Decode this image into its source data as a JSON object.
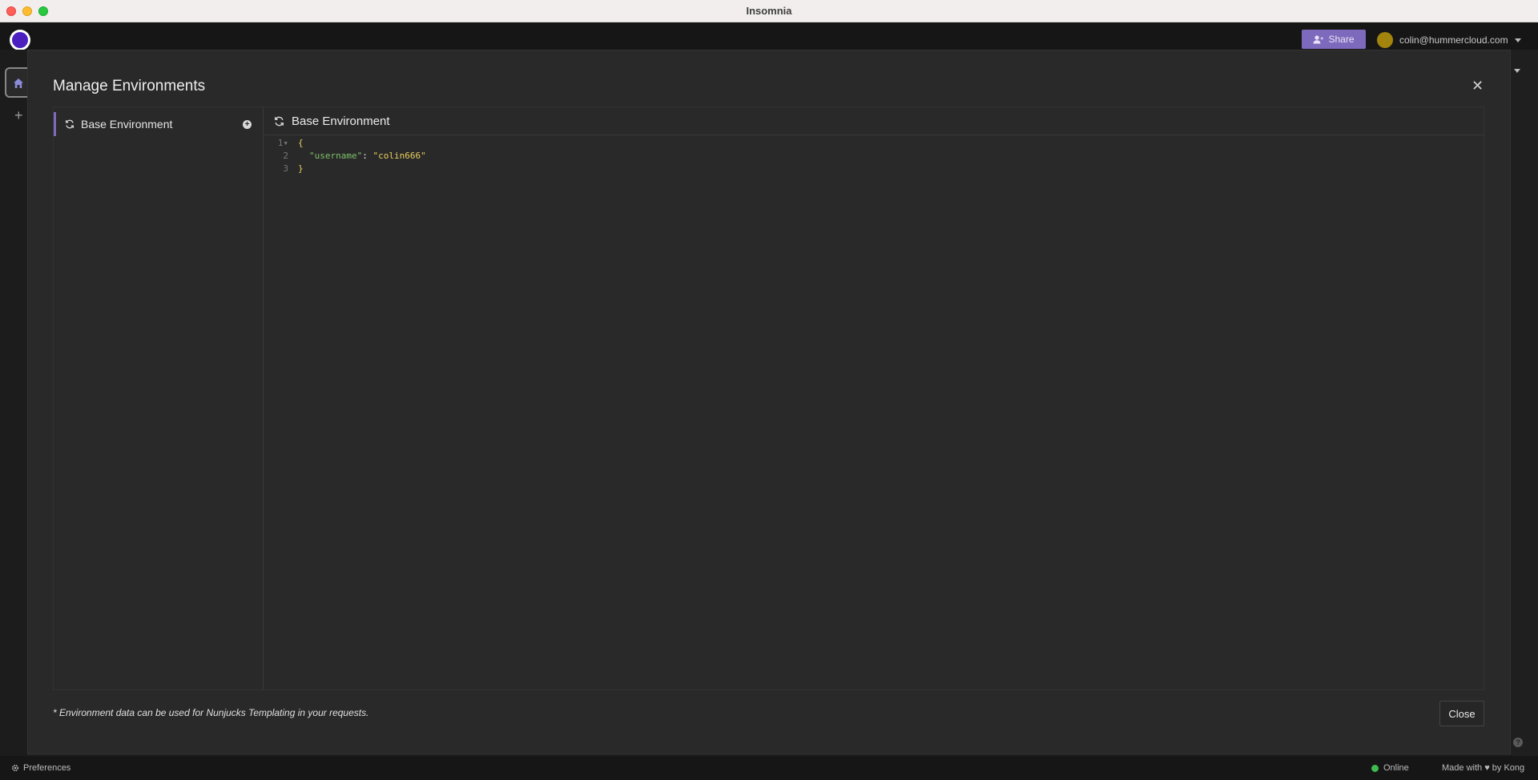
{
  "window": {
    "title": "Insomnia"
  },
  "header": {
    "share_label": "Share",
    "user_email": "colin@hummercloud.com"
  },
  "modal": {
    "title": "Manage Environments",
    "sidebar": {
      "items": [
        {
          "label": "Base Environment",
          "active": true
        }
      ]
    },
    "editor": {
      "title": "Base Environment",
      "lines": [
        {
          "num": "1",
          "fold": "▾",
          "open": "{"
        },
        {
          "num": "2",
          "key": "\"username\"",
          "sep": ": ",
          "value": "\"colin666\""
        },
        {
          "num": "3",
          "close": "}"
        }
      ]
    },
    "footer_note": "* Environment data can be used for Nunjucks Templating in your requests.",
    "close_label": "Close"
  },
  "statusbar": {
    "preferences_label": "Preferences",
    "online_label": "Online",
    "made_with": "Made with ♥ by Kong"
  },
  "colors": {
    "accent": "#7e6abc",
    "online": "#3fb950",
    "json_key": "#7ec26a",
    "json_string": "#e8cf5f"
  }
}
